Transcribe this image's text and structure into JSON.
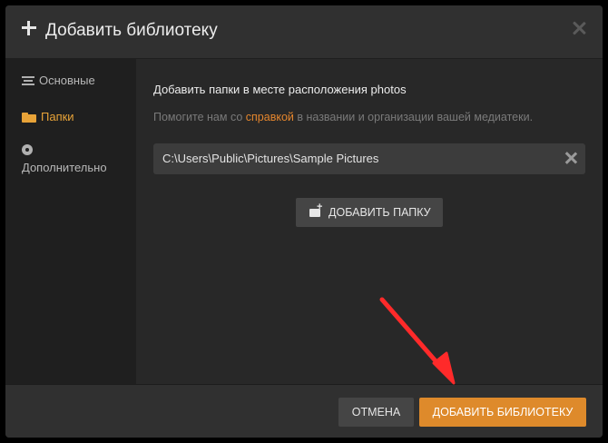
{
  "dialog": {
    "title": "Добавить библиотеку",
    "close_icon": "close-icon",
    "add_icon": "plus-icon"
  },
  "sidebar": {
    "items": [
      {
        "label": "Основные",
        "icon": "lines-icon",
        "active": false
      },
      {
        "label": "Папки",
        "icon": "folder-icon",
        "active": true
      },
      {
        "label": "Дополнительно",
        "icon": "gear-icon",
        "active": false
      }
    ]
  },
  "content": {
    "section_title": "Добавить папки в месте расположения photos",
    "help_prefix": "Помогите нам со ",
    "help_link": "справкой",
    "help_suffix": " в названии и организации вашей медиатеки.",
    "folder_path": "C:\\Users\\Public\\Pictures\\Sample Pictures",
    "add_folder_label": "ДОБАВИТЬ ПАПКУ"
  },
  "footer": {
    "cancel_label": "ОТМЕНА",
    "add_library_label": "ДОБАВИТЬ БИБЛИОТЕКУ"
  },
  "colors": {
    "accent": "#de8a2b",
    "link": "#e5862d",
    "annotation_arrow": "#ff2a2a"
  }
}
